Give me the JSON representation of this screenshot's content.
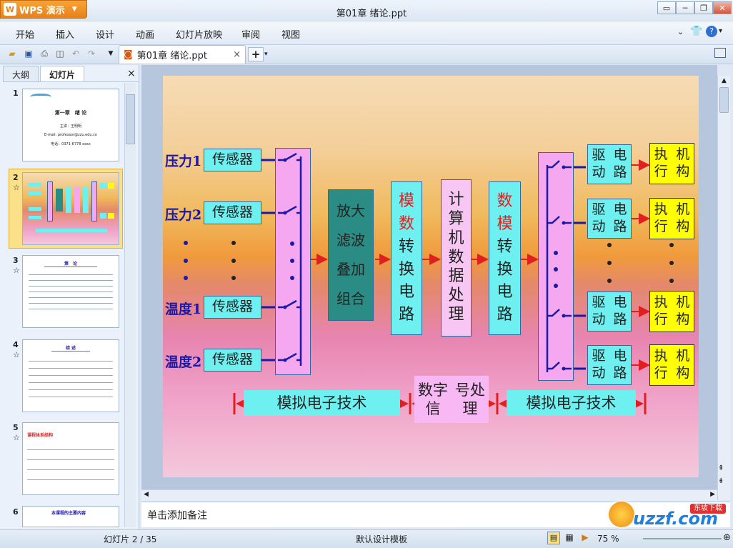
{
  "app": {
    "name": "WPS 演示",
    "logo": "W",
    "window_title": "第01章 绪论.ppt"
  },
  "menu": [
    "开始",
    "插入",
    "设计",
    "动画",
    "幻灯片放映",
    "审阅",
    "视图"
  ],
  "doc_tab": {
    "label": "第01章 绪论.ppt",
    "close": "×",
    "add": "+"
  },
  "panel": {
    "tabs": [
      "大纲",
      "幻灯片"
    ],
    "close": "×",
    "slide_numbers": [
      "1",
      "2",
      "3",
      "4",
      "5",
      "6"
    ],
    "star": "☆"
  },
  "thumbs": {
    "t1": {
      "title": "第一章　绪 论",
      "line1": "主讲：王明明",
      "line2": "E-mail: professor@zzu.edu.cn",
      "line3": "电话：0371-6778 xxxx"
    },
    "t3": {
      "title": "第　论"
    },
    "t4": {
      "title": "综 述"
    },
    "t5": {
      "title": "课程体系结构"
    },
    "t6": {
      "title": "本课程的主要内容"
    }
  },
  "slide": {
    "inputs": [
      "压力1",
      "压力2",
      "温度1",
      "温度2"
    ],
    "sensor": "传感器",
    "amp": [
      "放大",
      "滤波",
      "叠加",
      "组合"
    ],
    "adc": {
      "red": [
        "模",
        "数"
      ],
      "black": [
        "转",
        "换",
        "电",
        "路"
      ]
    },
    "cpu": [
      "计",
      "算",
      "机",
      "数",
      "据",
      "处",
      "理"
    ],
    "dac": {
      "red": [
        "数",
        "模"
      ],
      "black": [
        "转",
        "换",
        "电",
        "路"
      ]
    },
    "drive": [
      "驱动",
      "电路"
    ],
    "exec": [
      "执行",
      "机构"
    ],
    "analog_left": "模拟电子技术",
    "digital": [
      "数字信",
      "号处理"
    ],
    "analog_right": "模拟电子技术"
  },
  "notes": "单击添加备注",
  "status": {
    "slide": "幻灯片 2 / 35",
    "template": "默认设计模板",
    "zoom": "75 %"
  },
  "watermark": {
    "brand": "uzzf.com",
    "sub": "东坡下载"
  },
  "colors": {
    "accent": "#e8811a",
    "label": "#1c18a8",
    "cyan": "#6ef0f0",
    "yellow": "#ffff00",
    "teal": "#2a8c84",
    "pink": "#f5a8ef"
  }
}
